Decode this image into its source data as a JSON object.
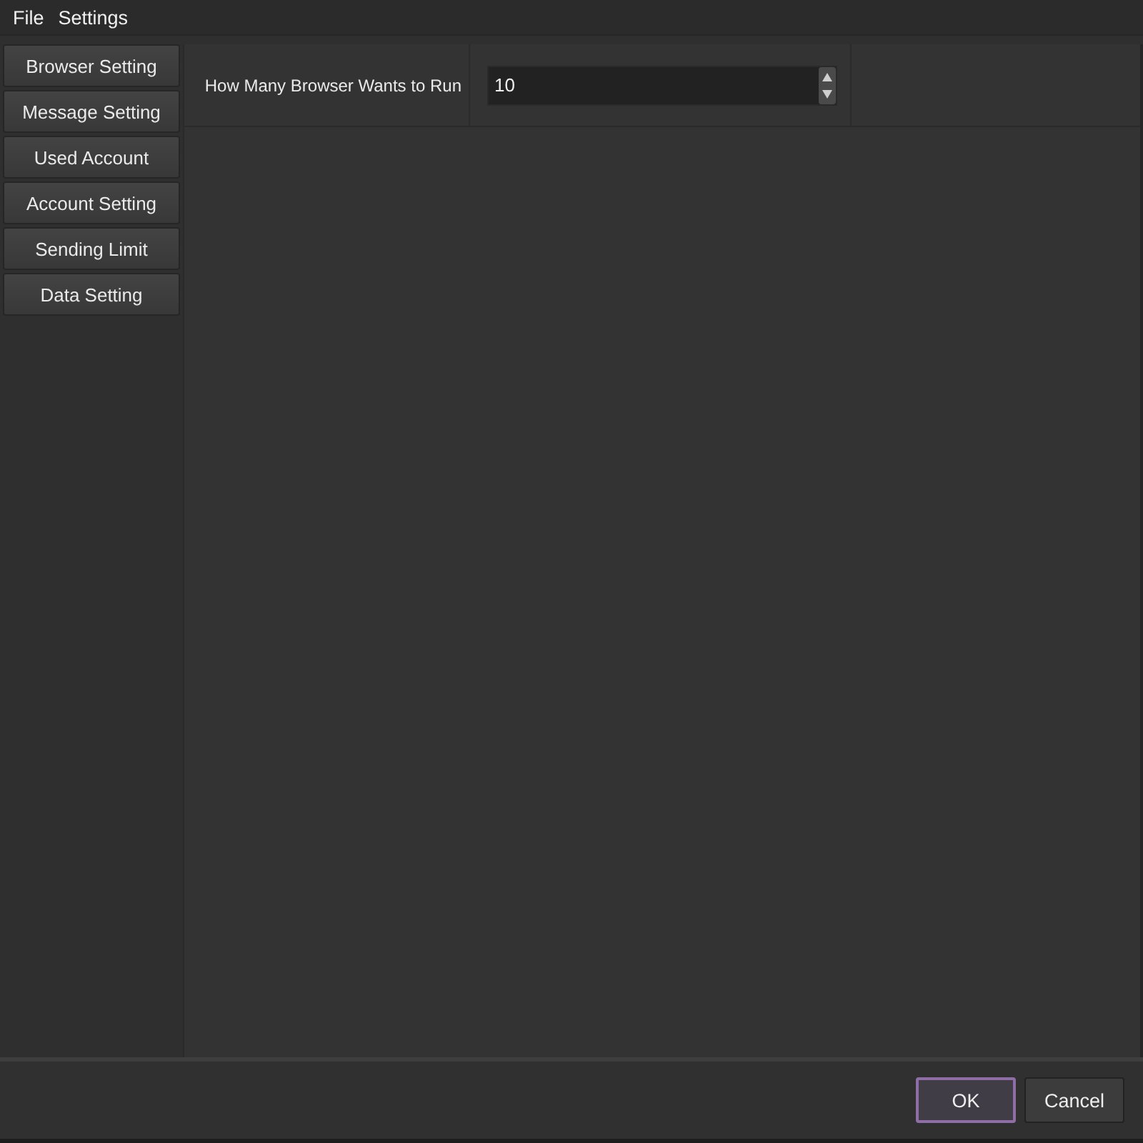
{
  "menu": [
    "File",
    "Settings"
  ],
  "sidebar": {
    "items": [
      "Browser Setting",
      "Message Setting",
      "Used Account",
      "Account Setting",
      "Sending Limit",
      "Data Setting"
    ]
  },
  "settings": [
    {
      "label": "How Many Browser Wants to Run",
      "value": "10"
    }
  ],
  "buttons": [
    {
      "label": "OK",
      "focused": true
    },
    {
      "label": "Cancel",
      "focused": false
    }
  ]
}
